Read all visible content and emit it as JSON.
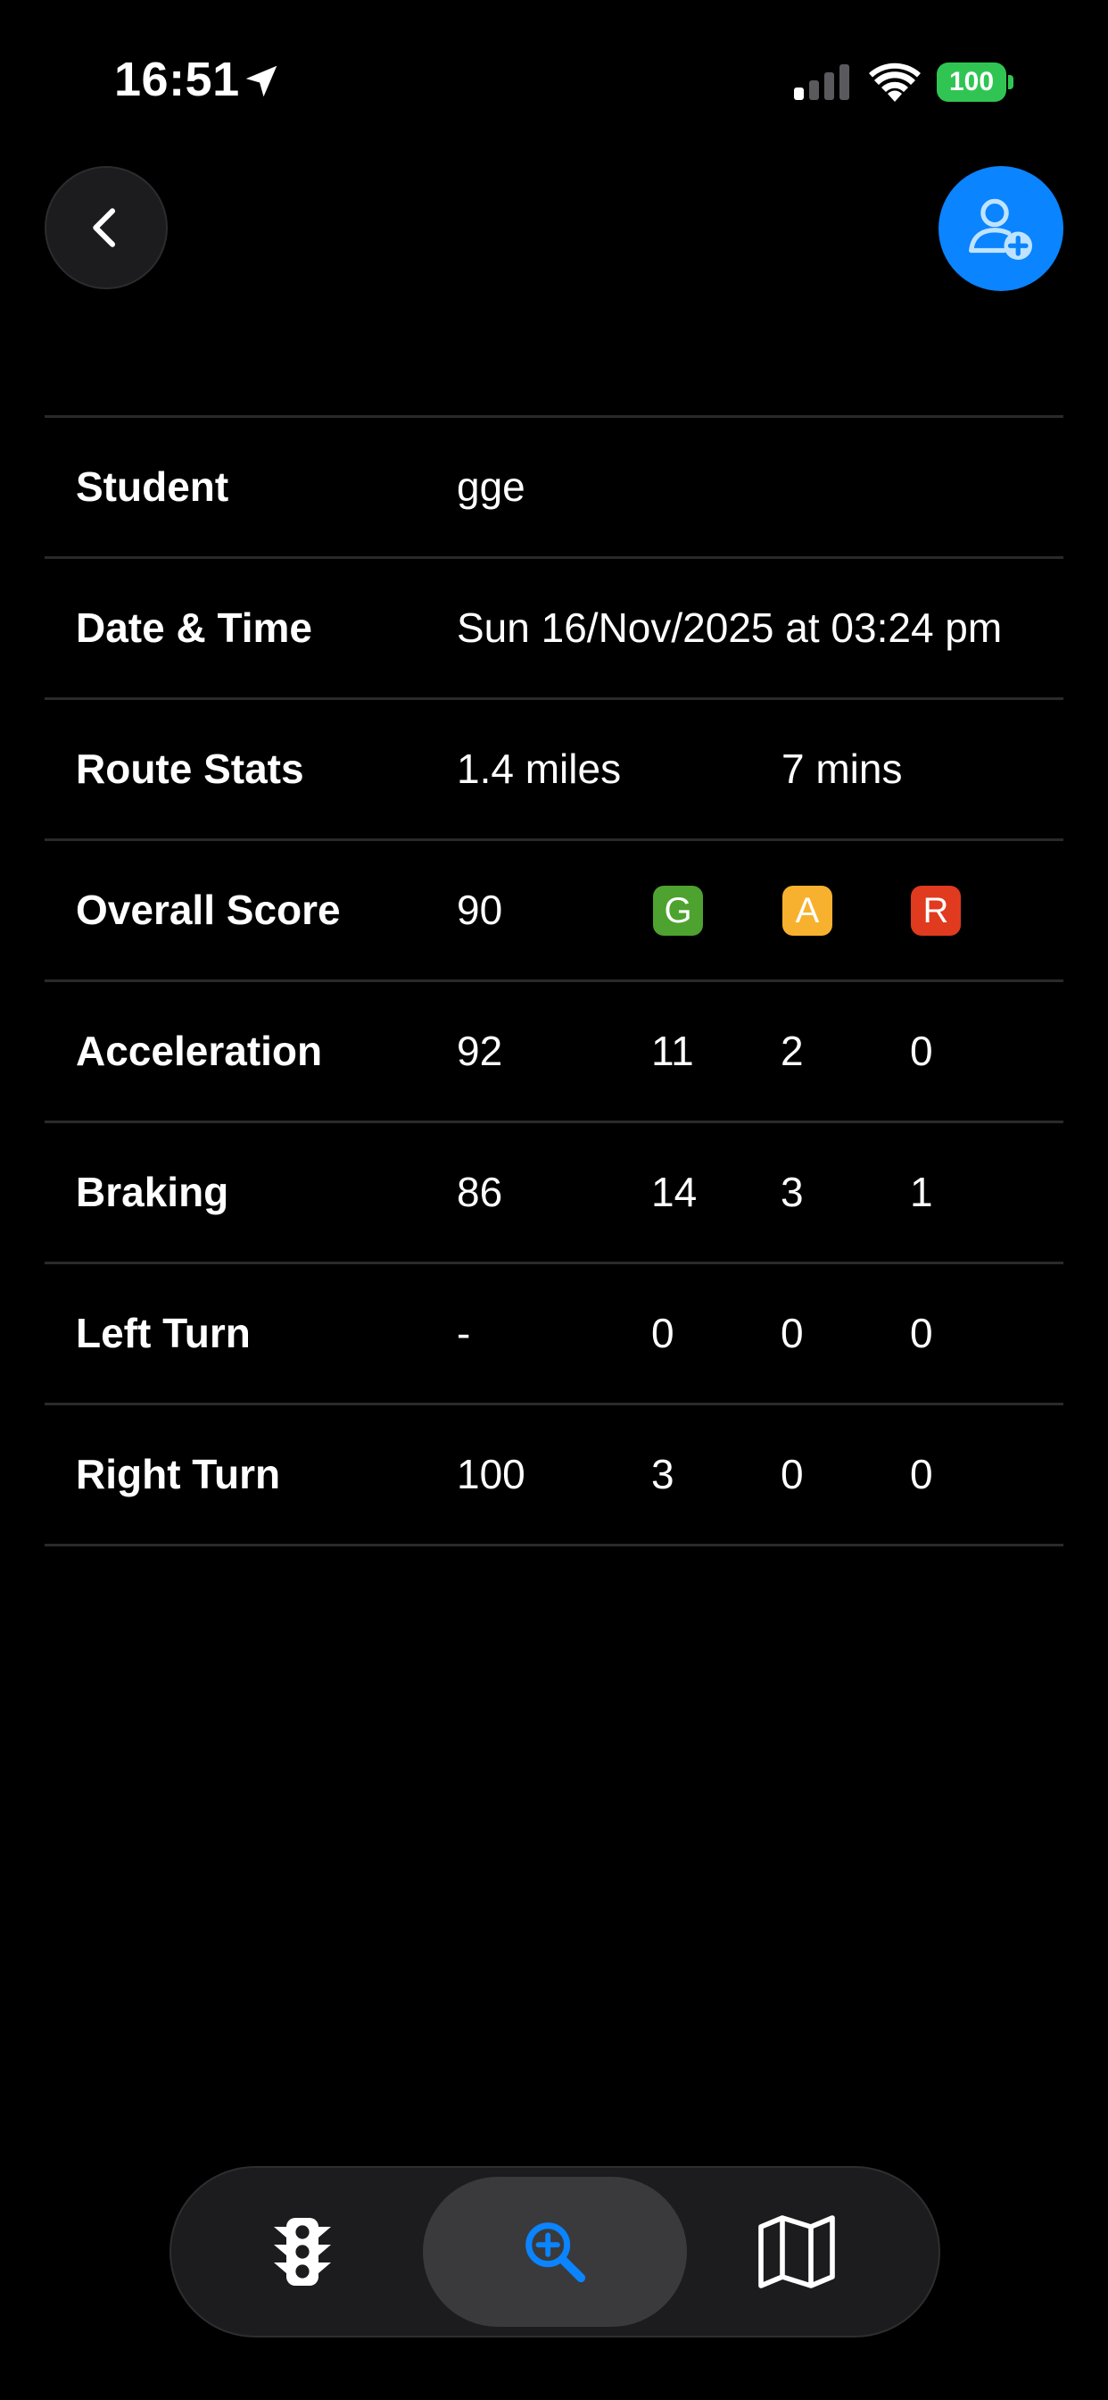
{
  "status_bar": {
    "time": "16:51",
    "battery": "100",
    "location_icon": "location-arrow-icon",
    "signal_icon": "cellular-signal-icon",
    "wifi_icon": "wifi-icon"
  },
  "header": {
    "back_icon": "chevron-left-icon",
    "add_student_icon": "person-add-icon"
  },
  "rows": {
    "student": {
      "label": "Student",
      "value": "gge"
    },
    "date_time": {
      "label": "Date & Time",
      "value": "Sun 16/Nov/2025 at 03:24 pm"
    },
    "route_stats": {
      "label": "Route Stats",
      "distance": "1.4 miles",
      "duration": "7 mins"
    },
    "overall_score": {
      "label": "Overall Score",
      "value": "90",
      "badge_g": "G",
      "badge_a": "A",
      "badge_r": "R"
    },
    "acceleration": {
      "label": "Acceleration",
      "score": "92",
      "g": "11",
      "a": "2",
      "r": "0"
    },
    "braking": {
      "label": "Braking",
      "score": "86",
      "g": "14",
      "a": "3",
      "r": "1"
    },
    "left_turn": {
      "label": "Left Turn",
      "score": "-",
      "g": "0",
      "a": "0",
      "r": "0"
    },
    "right_turn": {
      "label": "Right Turn",
      "score": "100",
      "g": "3",
      "a": "0",
      "r": "0"
    }
  },
  "tab_bar": {
    "tabs": [
      {
        "icon": "traffic-light-icon",
        "active": false
      },
      {
        "icon": "zoom-in-icon",
        "active": true
      },
      {
        "icon": "map-icon",
        "active": false
      }
    ]
  },
  "colors": {
    "background": "#000000",
    "accent": "#0a84ff",
    "badge_green": "#4ea22f",
    "badge_amber": "#f7b12e",
    "badge_red": "#e03a1f",
    "battery_green": "#30c553",
    "divider": "#2a2a2c"
  }
}
